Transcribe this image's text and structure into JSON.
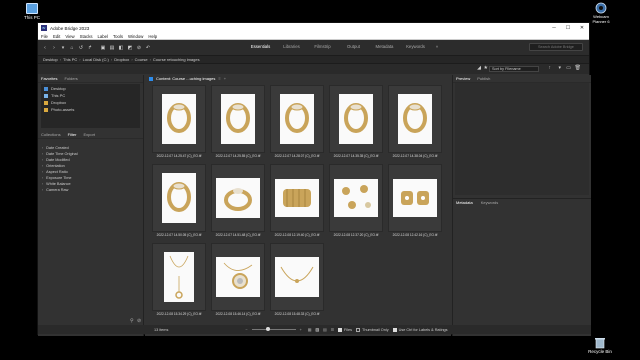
{
  "desktop": {
    "this_pc_label": "This PC",
    "webcam_label": "Webcam\nPlanner 6",
    "recycle_label": "Recycle Bin"
  },
  "window": {
    "title": "Adobe Bridge 2023",
    "menu": [
      "File",
      "Edit",
      "View",
      "Stacks",
      "Label",
      "Tools",
      "Window",
      "Help"
    ],
    "workspaces": [
      "Essentials",
      "Libraries",
      "Filmstrip",
      "Output",
      "Metadata",
      "Keywords"
    ],
    "active_workspace": "Essentials",
    "search_placeholder": "Search Adobe Bridge",
    "path": [
      "Desktop",
      "This PC",
      "Local Disk (C:)",
      "Dropbox",
      "Course",
      "Course retouching images"
    ],
    "sort_label": "Sort by Filename"
  },
  "left_panel": {
    "tabs": [
      "Favorites",
      "Folders"
    ],
    "favorites": [
      "Desktop",
      "This PC",
      "Dropbox",
      "Photo-assets"
    ],
    "filter_tabs": [
      "Collections",
      "Filter",
      "Export"
    ],
    "filters": [
      "Date Created",
      "Date Time Original",
      "Date Modified",
      "Orientation",
      "Aspect Ratio",
      "Exposure Time",
      "White Balance",
      "Camera Raw"
    ]
  },
  "content": {
    "tab_label": "Content: Course ...uching images",
    "items": [
      {
        "caption": "2022-12-07 14.25.47 (C)_EO.tif",
        "kind": "ring-tall"
      },
      {
        "caption": "2022-12-07 14.25.55 (C)_EO.tif",
        "kind": "ring-tall"
      },
      {
        "caption": "2022-12-07 14.28.07 (C)_EO.tif",
        "kind": "ring-tall"
      },
      {
        "caption": "2022-12-07 14.35.35 (C)_EO.tif",
        "kind": "ring-tall"
      },
      {
        "caption": "2022-12-07 14.38.04 (C)_EO.tif",
        "kind": "ring-tall"
      },
      {
        "caption": "2022-12-07 14.50.05 (C)_EO.tif",
        "kind": "ring-tall"
      },
      {
        "caption": "2022-12-07 14.51.48 (C)_EO.tif",
        "kind": "ring-wide"
      },
      {
        "caption": "2022-12-08 12.19.40 (C)_EO.tif",
        "kind": "cuff"
      },
      {
        "caption": "2022-12-08 12.37.20 (C)_EO.tif",
        "kind": "studs"
      },
      {
        "caption": "2022-12-08 12.42.16 (C)_EO.tif",
        "kind": "earrings"
      },
      {
        "caption": "2022-12-08 15.34.29 (C)_EO.tif",
        "kind": "necklace"
      },
      {
        "caption": "2022-12-08 15.46.14 (C)_EO.tif",
        "kind": "pendant"
      },
      {
        "caption": "2022-12-08 15.48.33 (C)_EO.tif",
        "kind": "bracelet"
      }
    ],
    "status_items": "13 items",
    "checkbox_files": "Files",
    "checkbox_thumbonly": "Thumbnail Only",
    "checkbox_ctrl": "Use Ctrl for Labels & Ratings"
  },
  "right_panel": {
    "tabs": [
      "Preview",
      "Publish"
    ],
    "lower_tabs": [
      "Metadata",
      "Keywords"
    ]
  },
  "colors": {
    "bg": "#323232",
    "accent": "#2d8ceb",
    "gold": "#c9a45a"
  }
}
